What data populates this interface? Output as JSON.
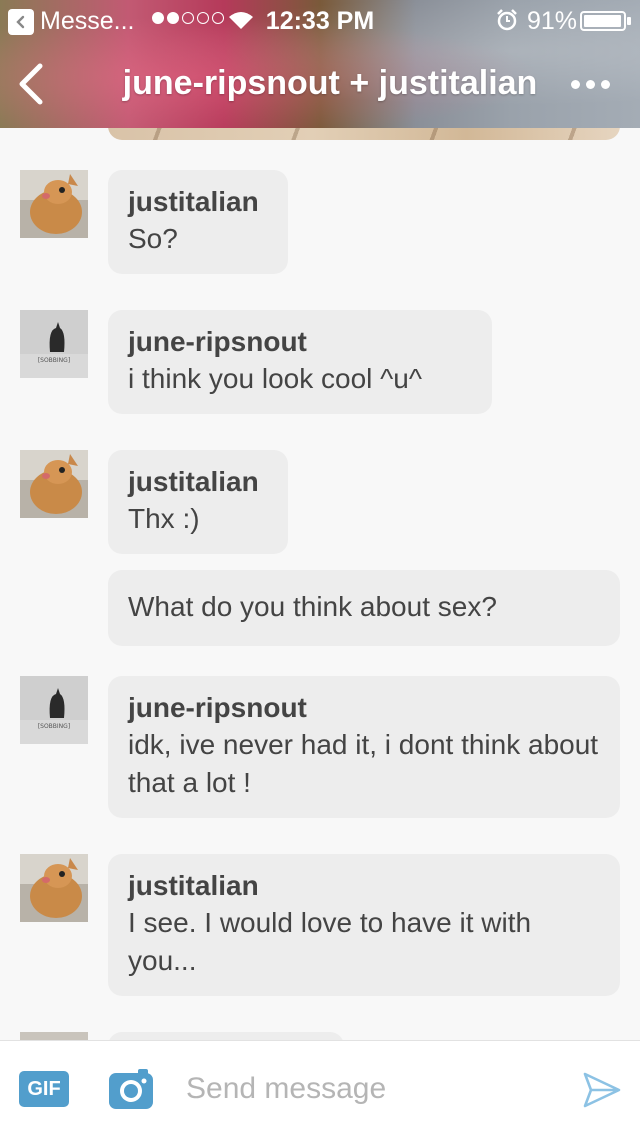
{
  "status_bar": {
    "back_app": "Messe...",
    "time": "12:33 PM",
    "battery": "91%",
    "signal_bars_filled": 2,
    "signal_bars_total": 5
  },
  "nav": {
    "title": "june-ripsnout + justitalian"
  },
  "messages": [
    {
      "sender": "justitalian",
      "text": "So?"
    },
    {
      "sender": "june-ripsnout",
      "text": "i think you look cool ^u^"
    },
    {
      "sender": "justitalian",
      "text": "Thx :)"
    },
    {
      "sender": "",
      "text": "What do you think about sex?"
    },
    {
      "sender": "june-ripsnout",
      "text": "idk, ive never had it, i dont think about that a lot !"
    },
    {
      "sender": "justitalian",
      "text": "I see. I would love to have it with you..."
    }
  ],
  "avatar_caption": "[SOBBING]",
  "composer": {
    "gif_label": "GIF",
    "placeholder": "Send message"
  },
  "colors": {
    "bubble": "#ededed",
    "accent": "#529ecc",
    "background": "#f8f8f8"
  }
}
